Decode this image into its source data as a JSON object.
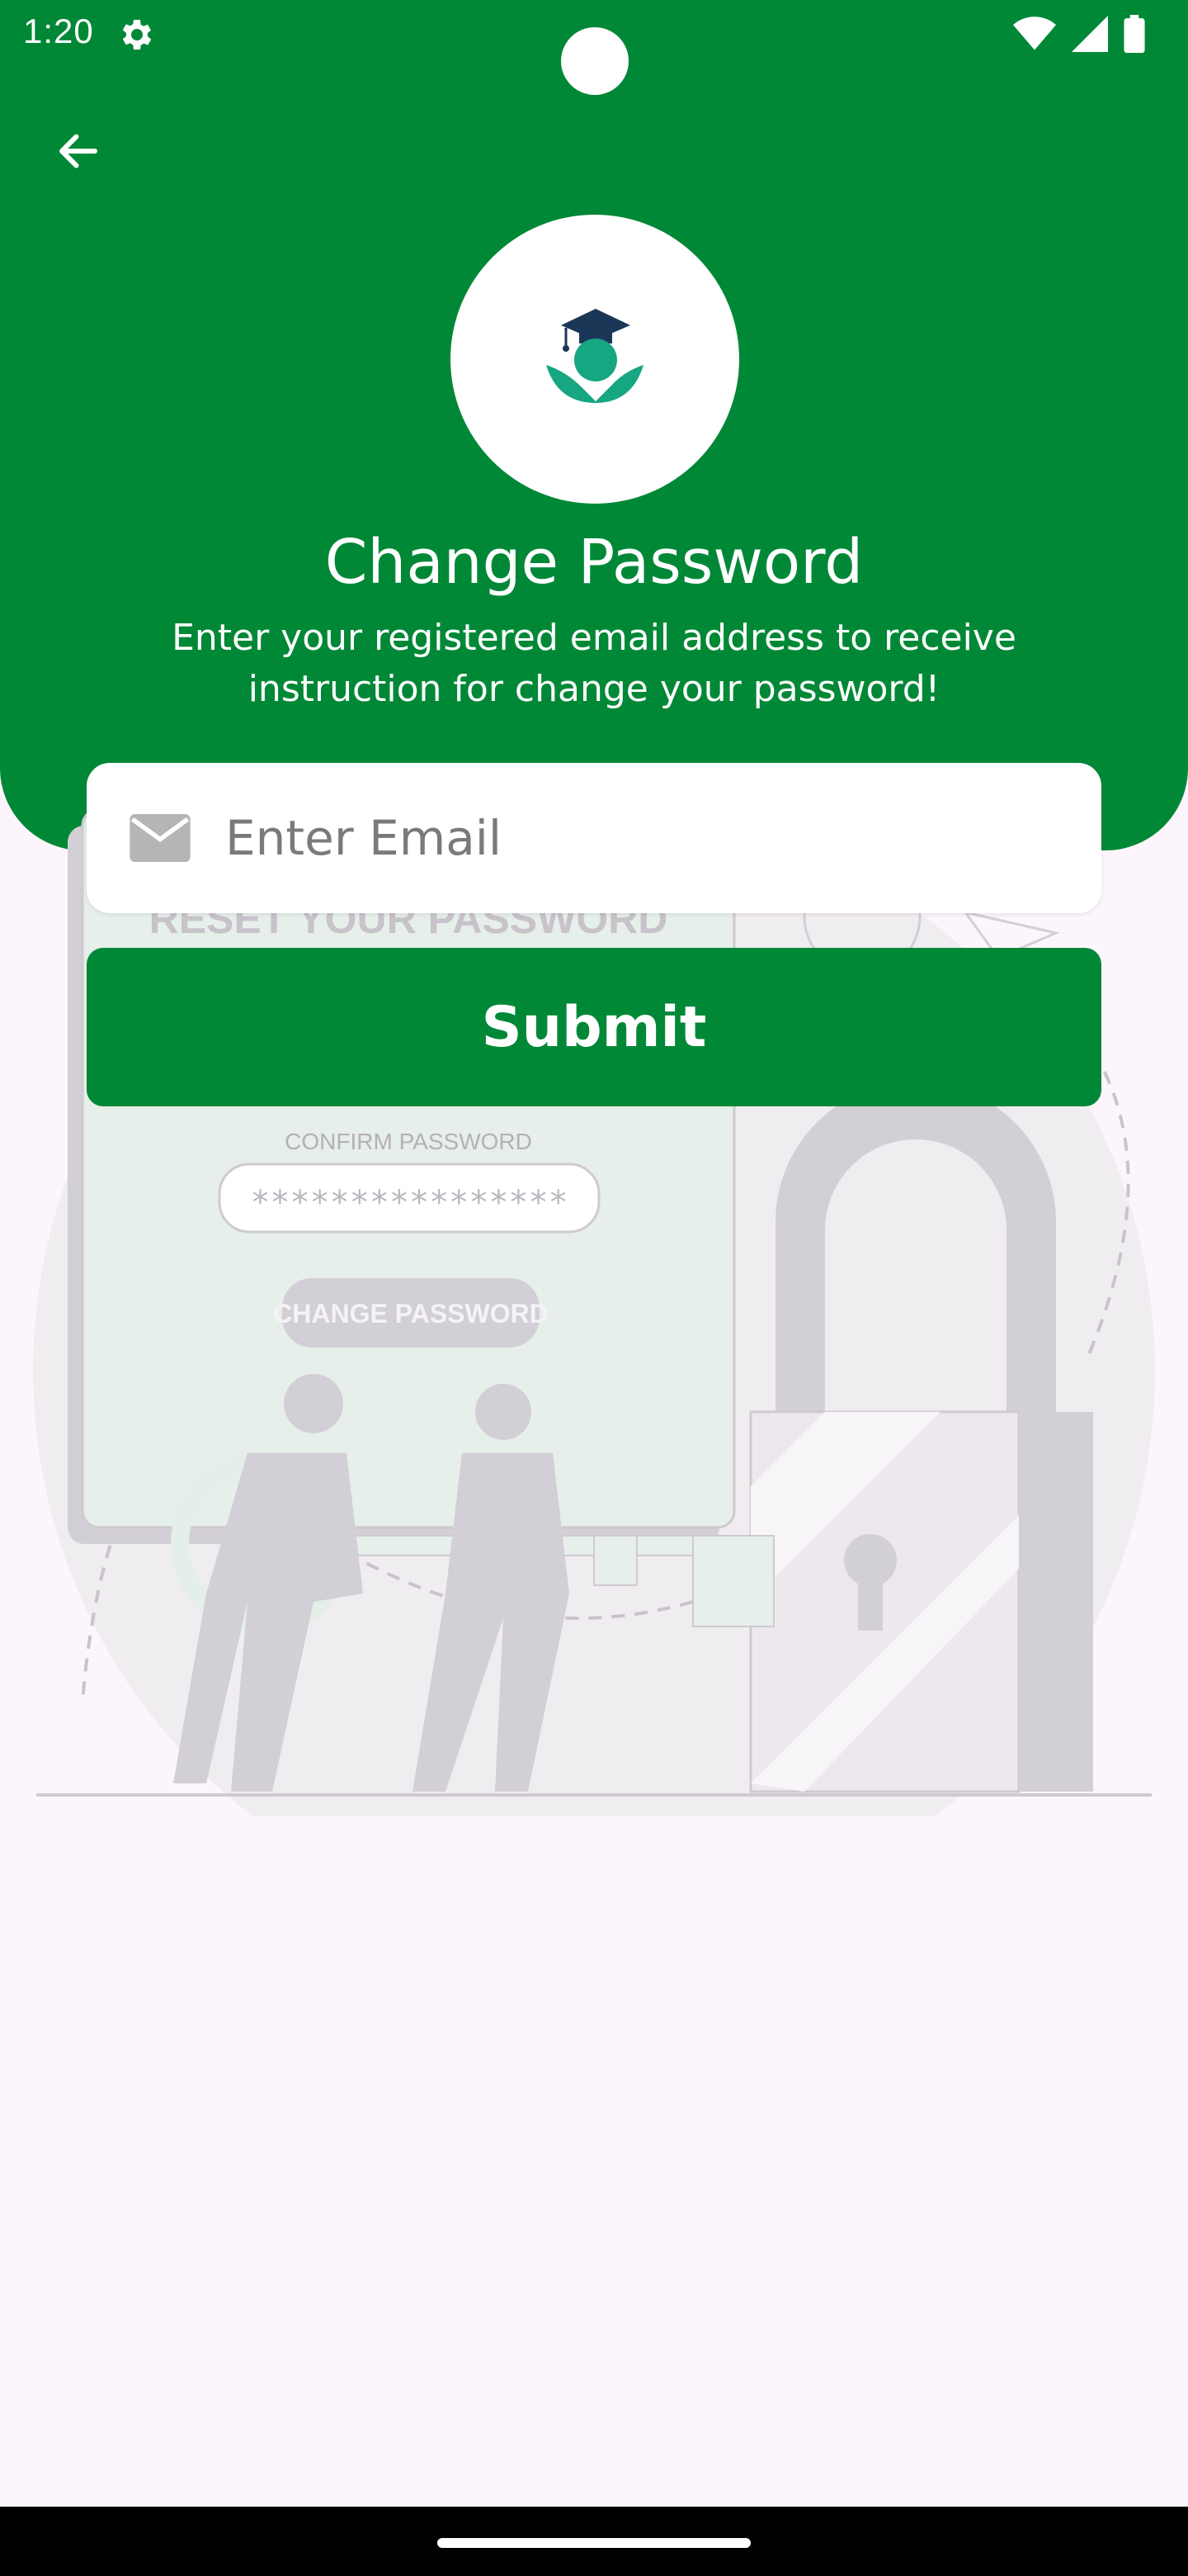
{
  "status_bar": {
    "time": "1:20"
  },
  "header": {
    "title": "Change Password",
    "subtitle": "Enter your registered email address to receive instruction for change your password!"
  },
  "form": {
    "email_placeholder": "Enter Email",
    "email_value": "",
    "submit_label": "Submit"
  },
  "illustration": {
    "heading": "RESET YOUR PASSWORD",
    "field_label": "CONFIRM PASSWORD",
    "field_value": "****************",
    "button_label": "CHANGE PASSWORD"
  },
  "icons": [
    "gear-icon",
    "wifi-icon",
    "signal-icon",
    "battery-icon",
    "back-arrow-icon",
    "graduation-logo-icon",
    "mail-icon"
  ],
  "colors": {
    "primary": "#008836",
    "background": "#fcf6fc",
    "white": "#ffffff"
  }
}
